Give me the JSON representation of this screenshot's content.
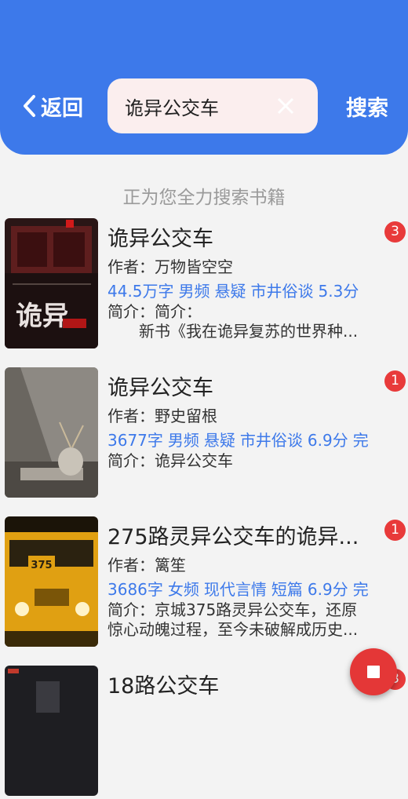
{
  "header": {
    "back_label": "返回",
    "search_value": "诡异公交车",
    "search_button": "搜索"
  },
  "status_text": "正为您全力搜索书籍",
  "books": [
    {
      "title": "诡异公交车",
      "author": "作者：万物皆空空",
      "tags": [
        "44.5万字",
        "男频",
        "悬疑",
        "市井俗谈",
        "5.3分"
      ],
      "intro": [
        "简介：简介：",
        "　　新书《我在诡异复苏的世界种..."
      ],
      "badge": "3",
      "cover_text": "诡异"
    },
    {
      "title": "诡异公交车",
      "author": "作者：野史留根",
      "tags": [
        "3677字",
        "男频",
        "悬疑",
        "市井俗谈",
        "6.9分",
        "完"
      ],
      "intro": [
        "简介：诡异公交车"
      ],
      "badge": "1"
    },
    {
      "title": "275路灵异公交车的诡异...",
      "author": "作者：篱笙",
      "tags": [
        "3686字",
        "女频",
        "现代言情",
        "短篇",
        "6.9分",
        "完"
      ],
      "intro": [
        "简介：京城375路灵异公交车，还原",
        "惊心动魄过程，至今未破解成历史..."
      ],
      "badge": "1",
      "cover_text": "375"
    },
    {
      "title": "18路公交车",
      "badge": "3"
    }
  ]
}
